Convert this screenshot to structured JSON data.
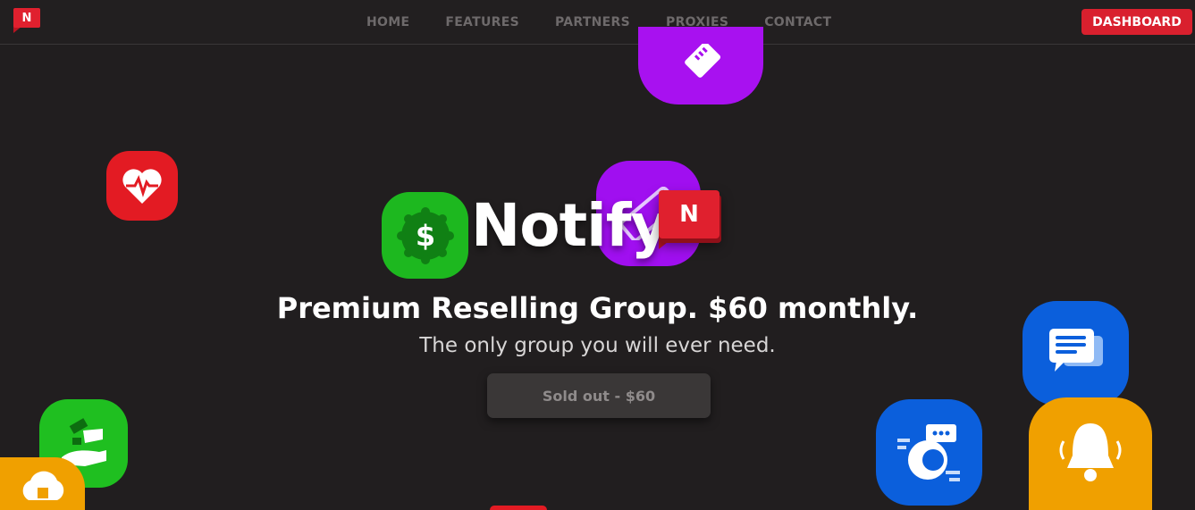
{
  "nav": {
    "logo_letter": "N",
    "items": [
      {
        "label": "HOME"
      },
      {
        "label": "FEATURES"
      },
      {
        "label": "PARTNERS"
      },
      {
        "label": "PROXIES"
      },
      {
        "label": "CONTACT"
      }
    ],
    "dashboard_label": "DASHBOARD"
  },
  "hero": {
    "brand": "Notify",
    "brand_badge_letter": "N",
    "headline": "Premium Reselling Group. $60 monthly.",
    "subline": "The only group you will ever need.",
    "cta_label": "Sold out - $60"
  },
  "icons": [
    {
      "name": "purple-ticket-icon",
      "color": "#a811f0"
    },
    {
      "name": "heart-pulse-icon",
      "color": "#e31b23"
    },
    {
      "name": "dollar-badge-icon",
      "color": "#1db81f"
    },
    {
      "name": "purple-tag-icon",
      "color": "#a00ff0"
    },
    {
      "name": "chat-messages-icon",
      "color": "#0b5fdc"
    },
    {
      "name": "handshake-icon",
      "color": "#1fbf20"
    },
    {
      "name": "support-chat-icon",
      "color": "#0b5fdc"
    },
    {
      "name": "bell-icon",
      "color": "#f0a000"
    },
    {
      "name": "cloud-chip-icon",
      "color": "#f0a000"
    }
  ],
  "colors": {
    "background": "#211e1f",
    "accent": "#e0202e"
  }
}
